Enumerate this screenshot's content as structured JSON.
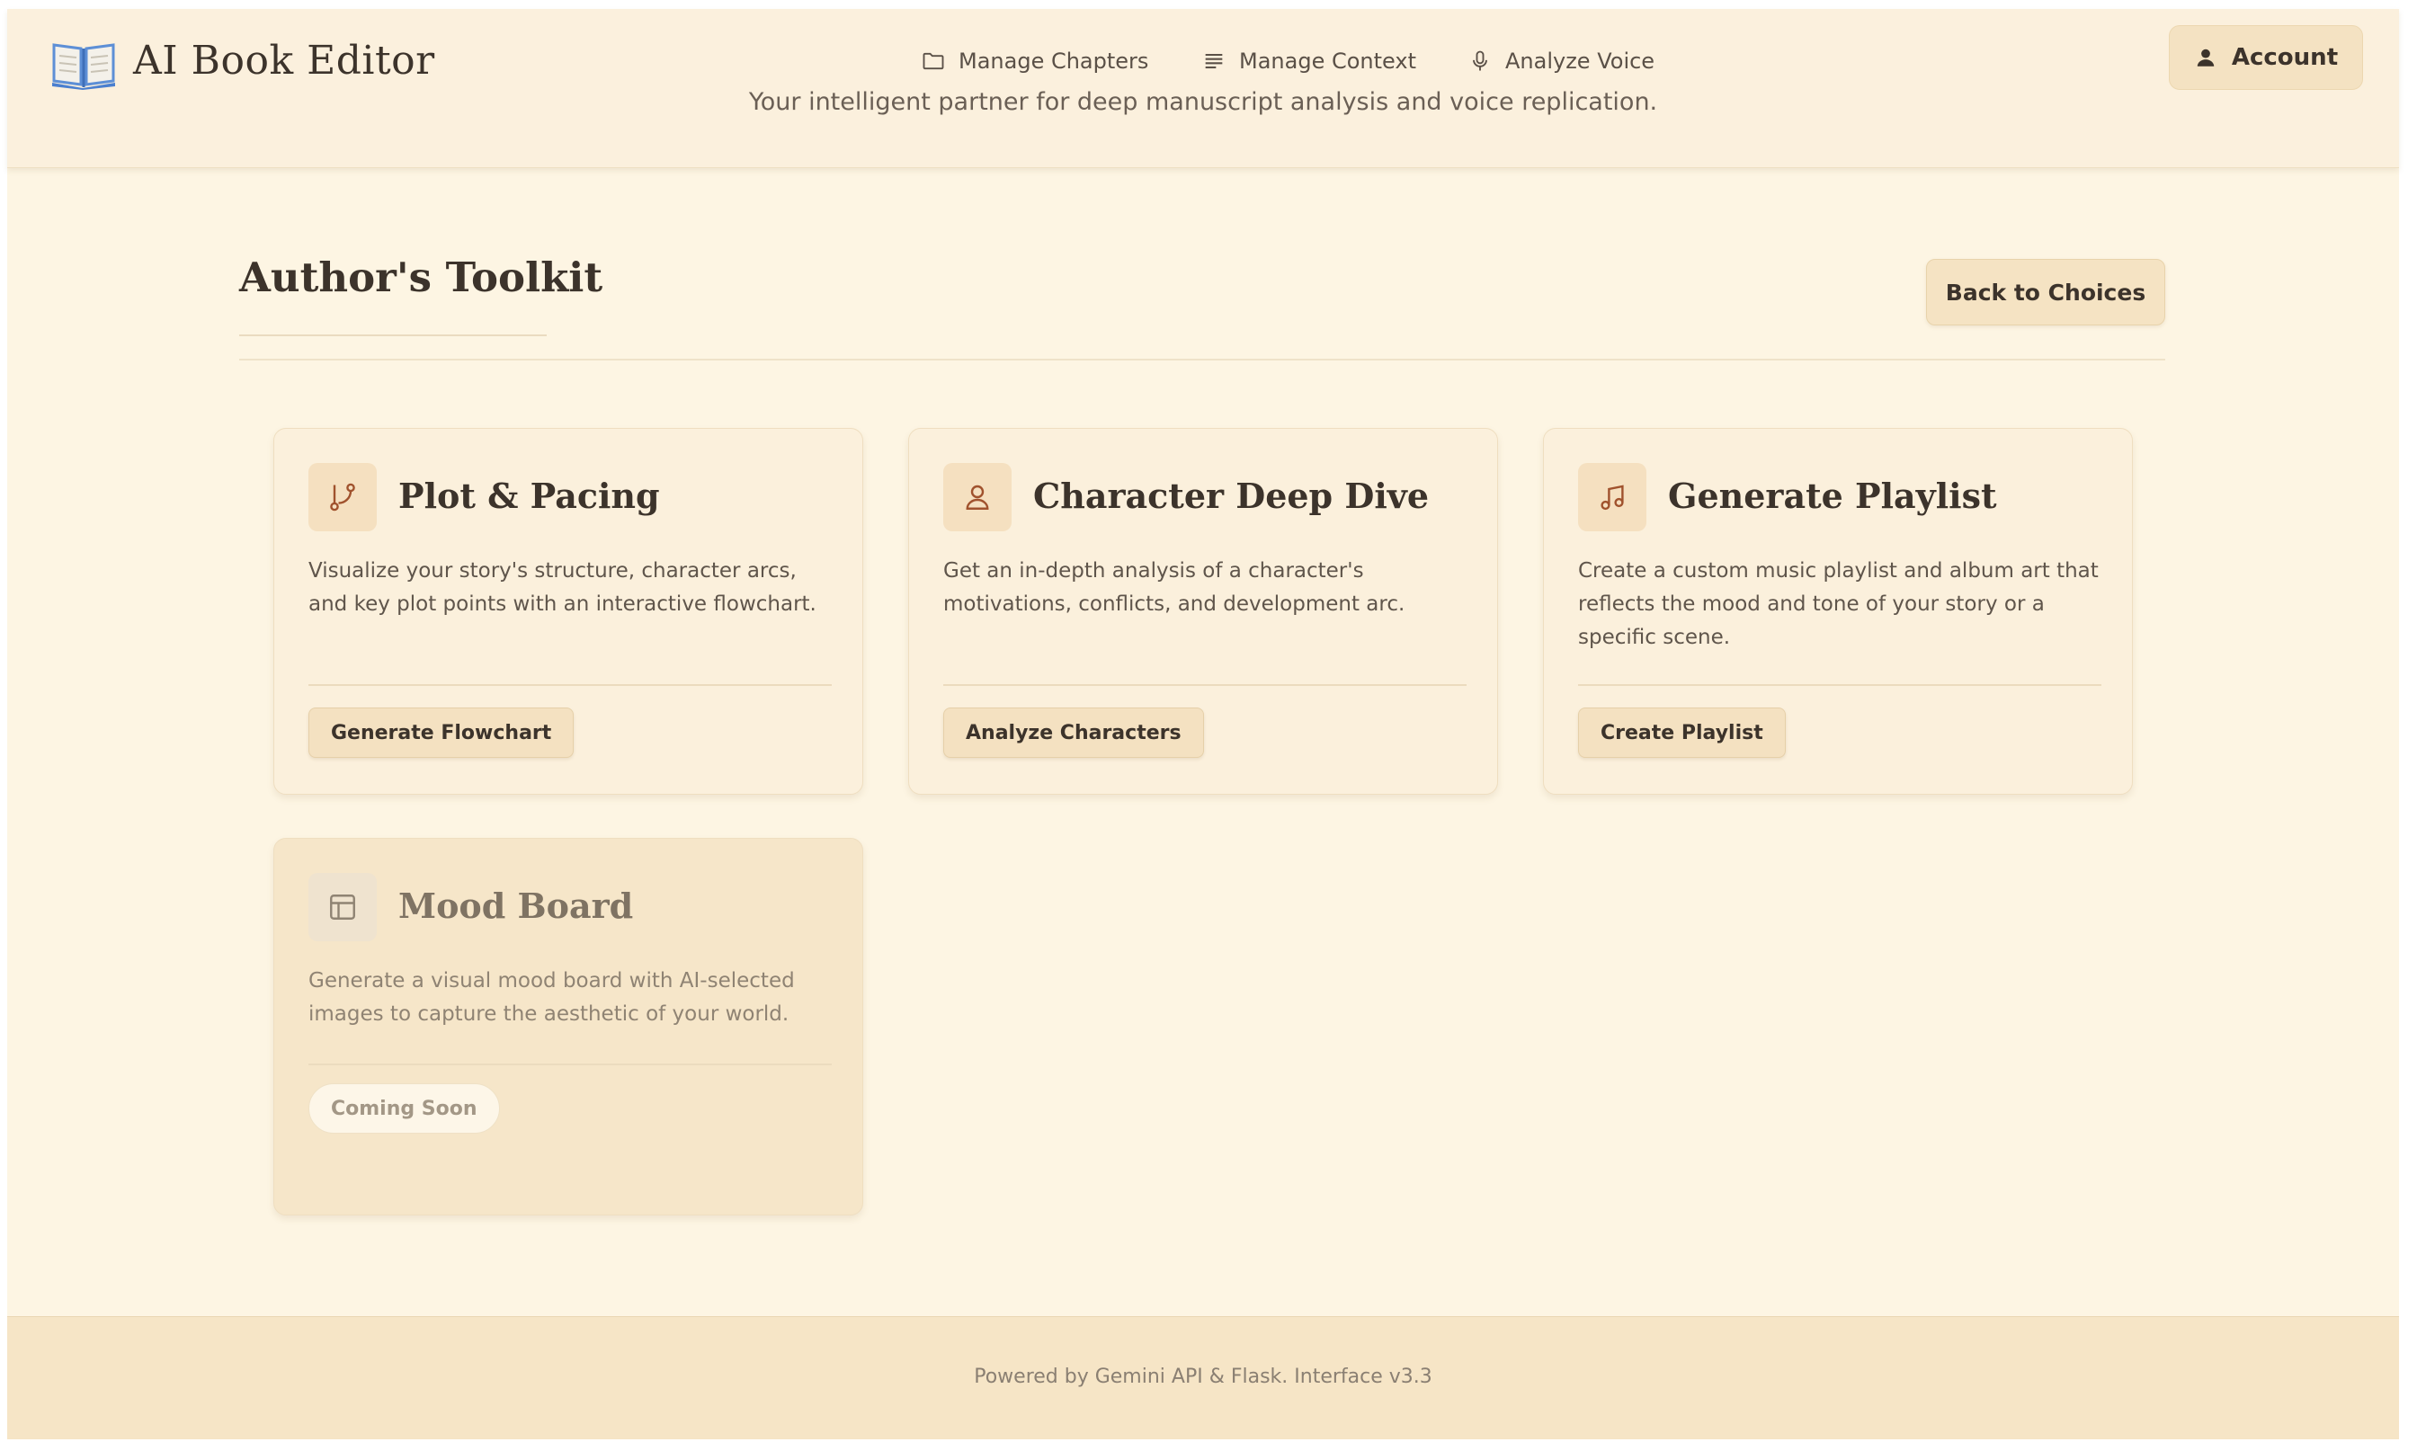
{
  "header": {
    "app_title": "AI Book Editor",
    "logo_icon": "open-book-icon",
    "tagline": "Your intelligent partner for deep manuscript analysis and voice replication.",
    "nav": [
      {
        "label": "Manage Chapters",
        "icon": "folder-icon"
      },
      {
        "label": "Manage Context",
        "icon": "text-lines-icon"
      },
      {
        "label": "Analyze Voice",
        "icon": "microphone-icon"
      }
    ],
    "account_label": "Account",
    "account_icon": "user-icon"
  },
  "toolkit": {
    "title": "Author's Toolkit",
    "back_label": "Back to Choices"
  },
  "cards": [
    {
      "title": "Plot & Pacing",
      "icon": "git-branch-icon",
      "description": "Visualize your story's structure, character arcs, and key plot points with an interactive flowchart.",
      "button": "Generate Flowchart",
      "enabled": true
    },
    {
      "title": "Character Deep Dive",
      "icon": "user-icon",
      "description": "Get an in-depth analysis of a character's motivations, conflicts, and development arc.",
      "button": "Analyze Characters",
      "enabled": true
    },
    {
      "title": "Generate Playlist",
      "icon": "music-note-icon",
      "description": "Create a custom music playlist and album art that reflects the mood and tone of your story or a specific scene.",
      "button": "Create Playlist",
      "enabled": true
    },
    {
      "title": "Mood Board",
      "icon": "layout-icon",
      "description": "Generate a visual mood board with AI-selected images to capture the aesthetic of your world.",
      "button": "Coming Soon",
      "enabled": false
    }
  ],
  "footer": {
    "text": "Powered by Gemini API & Flask. Interface v3.3"
  },
  "colors": {
    "background": "#fdf5e3",
    "header_bg": "#fbf0dd",
    "accent_icon": "#a0522d",
    "button_bg": "#f4e1c1",
    "footer_bg": "#f6e5c6"
  }
}
